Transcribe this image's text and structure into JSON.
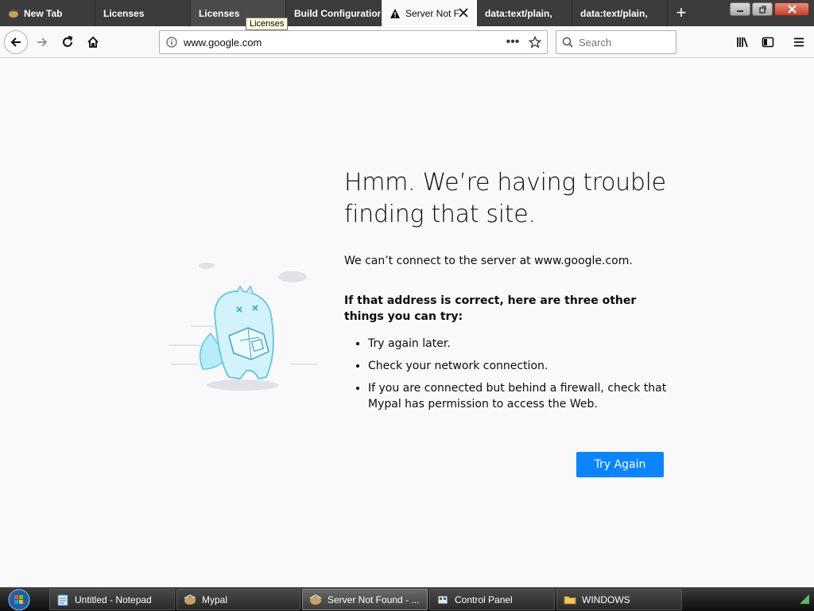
{
  "browser": {
    "tabs": [
      {
        "label": "New Tab",
        "state": "normal",
        "icon": "mypal-icon"
      },
      {
        "label": "Licenses",
        "state": "normal",
        "icon": ""
      },
      {
        "label": "Licenses",
        "state": "hovered",
        "icon": ""
      },
      {
        "label": "Build Configuration",
        "state": "normal",
        "icon": ""
      },
      {
        "label": "Server Not F",
        "state": "active",
        "icon": "warning-icon"
      },
      {
        "label": "data:text/plain,",
        "state": "normal",
        "icon": ""
      },
      {
        "label": "data:text/plain,",
        "state": "normal",
        "icon": ""
      }
    ],
    "new_tab_glyph": "+",
    "tooltip": "Licenses",
    "url": "www.google.com",
    "page_actions_glyph": "•••",
    "search_placeholder": "Search"
  },
  "error_page": {
    "title": "Hmm. We’re having trouble finding that site.",
    "description": "We can’t connect to the server at www.google.com.",
    "suggestions_heading": "If that address is correct, here are three other things you can try:",
    "suggestions": [
      "Try again later.",
      "Check your network connection.",
      "If you are connected but behind a firewall, check that Mypal has permission to access the Web."
    ],
    "try_again_label": "Try Again"
  },
  "taskbar": {
    "items": [
      {
        "label": "Untitled - Notepad",
        "icon": "notepad-icon",
        "active": false
      },
      {
        "label": "Mypal",
        "icon": "mypal-icon",
        "active": false
      },
      {
        "label": "Server Not Found - ...",
        "icon": "mypal-icon",
        "active": true
      },
      {
        "label": "Control Panel",
        "icon": "control-panel-icon",
        "active": false
      },
      {
        "label": "WINDOWS",
        "icon": "folder-icon",
        "active": false
      }
    ]
  },
  "colors": {
    "accent": "#0a84ff",
    "tabstrip": "#3c3c3c",
    "page_background": "#f9f9fa"
  }
}
